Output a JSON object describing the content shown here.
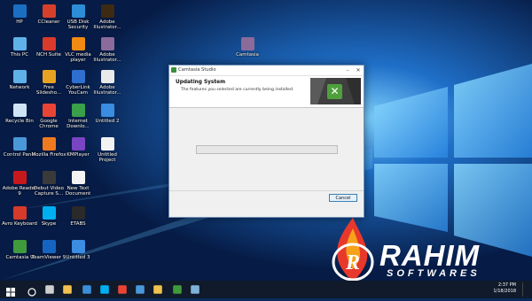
{
  "desktop_icons": [
    {
      "label": "HP",
      "icon": "hp-icon",
      "color": "#1b6fc2"
    },
    {
      "label": "CCleaner",
      "icon": "ccleaner-icon",
      "color": "#d6402a"
    },
    {
      "label": "USB Disk Security",
      "icon": "usb-disk-security-icon",
      "color": "#2c8ed6"
    },
    {
      "label": "Adobe Illustrator...",
      "icon": "adobe-illustrator-icon",
      "color": "#3d2a12"
    },
    {
      "label": "This PC",
      "icon": "this-pc-icon",
      "color": "#5fb2e8"
    },
    {
      "label": "NCH Suite",
      "icon": "nch-suite-icon",
      "color": "#d93a2b"
    },
    {
      "label": "VLC media player",
      "icon": "vlc-icon",
      "color": "#f08a13"
    },
    {
      "label": "Adobe Illustrator...",
      "icon": "adobe-illustrator-installer-icon",
      "color": "#8b6b9a"
    },
    {
      "label": "Network",
      "icon": "network-icon",
      "color": "#5fb2e8"
    },
    {
      "label": "Free Slidesho...",
      "icon": "free-slideshow-icon",
      "color": "#e6a321"
    },
    {
      "label": "CyberLink YouCam",
      "icon": "cyberlink-youcam-icon",
      "color": "#2e6fd0"
    },
    {
      "label": "Adobe Illustrator...",
      "icon": "adobe-illustrator-doc-icon",
      "color": "#e9e9e9"
    },
    {
      "label": "Recycle Bin",
      "icon": "recycle-bin-icon",
      "color": "#cfe5f5"
    },
    {
      "label": "Google Chrome",
      "icon": "google-chrome-icon",
      "color": "#e84435"
    },
    {
      "label": "Internet Downlo...",
      "icon": "internet-download-manager-icon",
      "color": "#3aa04a"
    },
    {
      "label": "Untitled 2",
      "icon": "untitled-2-icon",
      "color": "#3a8de0"
    },
    {
      "label": "Control Panel",
      "icon": "control-panel-icon",
      "color": "#4a98d8"
    },
    {
      "label": "Mozilla Firefox",
      "icon": "firefox-icon",
      "color": "#f07a1f"
    },
    {
      "label": "KMPlayer",
      "icon": "kmplayer-icon",
      "color": "#7a45c2"
    },
    {
      "label": "Untitled Project",
      "icon": "untitled-project-icon",
      "color": "#f2f2f2"
    },
    {
      "label": "Adobe Reader 9",
      "icon": "adobe-reader-icon",
      "color": "#c7191c"
    },
    {
      "label": "Debut Video Capture S...",
      "icon": "debut-video-capture-icon",
      "color": "#3a3a3a"
    },
    {
      "label": "New Text Document",
      "icon": "text-document-icon",
      "color": "#f4f4f4"
    },
    {
      "label": "Avro Keyboard",
      "icon": "avro-keyboard-icon",
      "color": "#d63a2a"
    },
    {
      "label": "Skype",
      "icon": "skype-icon",
      "color": "#00aff0"
    },
    {
      "label": "ETABS",
      "icon": "etabs-icon",
      "color": "#2a2a2a"
    },
    {
      "label": "Camtasia 9",
      "icon": "camtasia-9-icon",
      "color": "#3f9b3c"
    },
    {
      "label": "TeamViewer 9",
      "icon": "teamviewer-icon",
      "color": "#1565c0"
    },
    {
      "label": "Untitled 3",
      "icon": "untitled-3-icon",
      "color": "#3a8de0"
    },
    {
      "label": "Camtasia",
      "icon": "camtasia-installer-icon",
      "color": "#8b6b9a"
    }
  ],
  "installer": {
    "window_title": "Camtasia Studio",
    "heading": "Updating System",
    "subheading": "The features you selected are currently being installed.",
    "progress_fraction": 0,
    "cancel_label": "Cancel",
    "logo_icon": "camtasia-logo-icon",
    "accent": "#4fa03d"
  },
  "watermark": {
    "line1": "RAHIM",
    "line2": "SOFTWARES"
  },
  "taskbar": {
    "items": [
      "start-icon",
      "search-icon",
      "task-view-icon",
      "file-explorer-icon",
      "store-icon",
      "skype-icon",
      "chrome-icon",
      "photos-icon",
      "explorer-window-icon",
      "camtasia-icon",
      "installer-icon"
    ],
    "time": "2:37 PM",
    "date": "1/18/2018",
    "background": "#101a2a"
  },
  "colors": {
    "wallpaper_dark": "#0a2a5c",
    "wallpaper_light": "#5fc0ff"
  }
}
